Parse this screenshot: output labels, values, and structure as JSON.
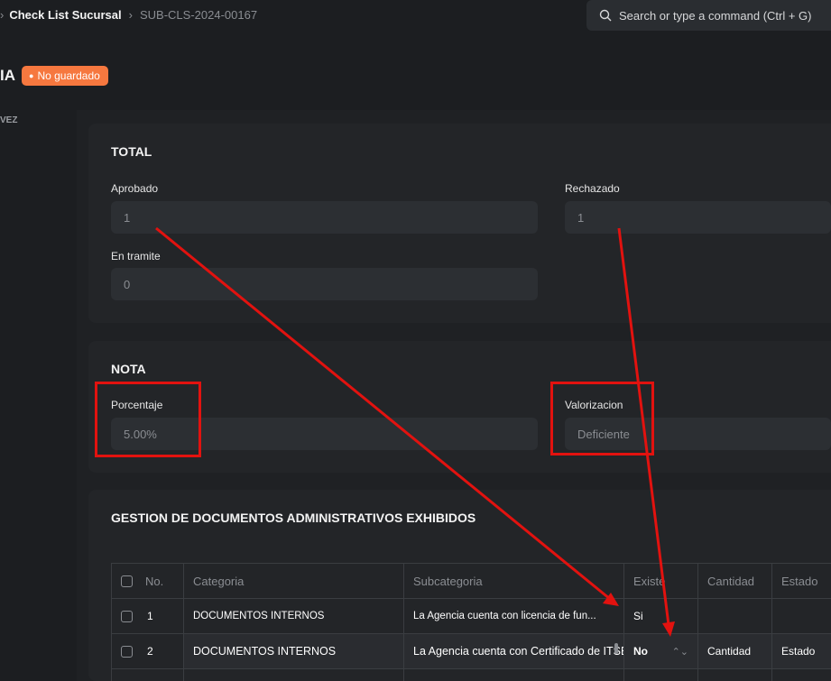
{
  "breadcrumb": {
    "doctype": "Check List Sucursal",
    "docname": "SUB-CLS-2024-00167"
  },
  "search": {
    "placeholder": "Search or type a command (Ctrl + G)"
  },
  "header": {
    "title": "IA",
    "status_badge": "No guardado",
    "side_text": "VEZ"
  },
  "total": {
    "title": "TOTAL",
    "aprobado_label": "Aprobado",
    "aprobado_value": "1",
    "rechazado_label": "Rechazado",
    "rechazado_value": "1",
    "en_tramite_label": "En tramite",
    "en_tramite_value": "0"
  },
  "nota": {
    "title": "NOTA",
    "porcentaje_label": "Porcentaje",
    "porcentaje_value": "5.00%",
    "valorizacion_label": "Valorizacion",
    "valorizacion_value": "Deficiente"
  },
  "gestion": {
    "title": "GESTION DE DOCUMENTOS ADMINISTRATIVOS EXHIBIDOS",
    "columns": {
      "no": "No.",
      "categoria": "Categoria",
      "subcategoria": "Subcategoria",
      "existe": "Existe",
      "cantidad": "Cantidad",
      "estado": "Estado"
    },
    "rows": [
      {
        "no": "1",
        "categoria": "DOCUMENTOS INTERNOS",
        "subcategoria": "La Agencia cuenta con licencia de fun...",
        "existe": "Si",
        "cantidad": "",
        "estado": ""
      },
      {
        "no": "2",
        "categoria": "DOCUMENTOS INTERNOS",
        "subcategoria": "La Agencia cuenta con Certificado de ITSE – Defensa Civil vigente y...",
        "existe": "No",
        "cantidad_placeholder": "Cantidad",
        "estado_placeholder": "Estado"
      }
    ]
  },
  "colors": {
    "background": "#1c1e21",
    "card": "#232528",
    "input": "#2c2f33",
    "badge": "#f6783f",
    "annotation": "#e2120f"
  }
}
